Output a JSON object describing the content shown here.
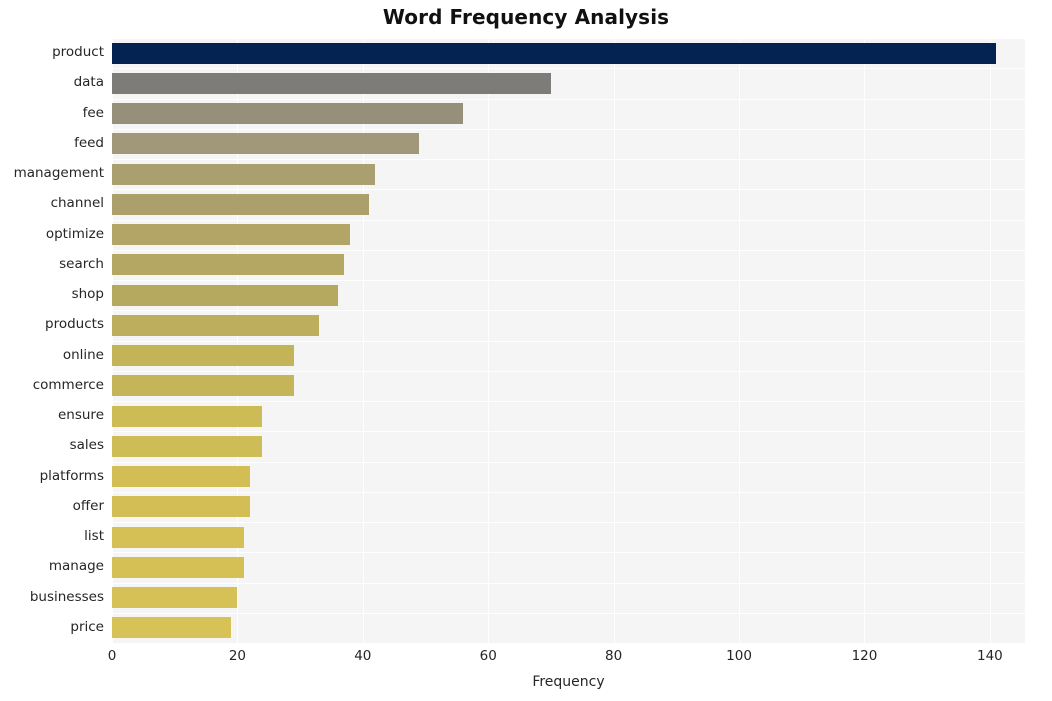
{
  "chart_data": {
    "type": "bar",
    "orientation": "horizontal",
    "title": "Word Frequency Analysis",
    "xlabel": "Frequency",
    "ylabel": "",
    "xlim": [
      0,
      145.6
    ],
    "xticks": [
      0,
      20,
      40,
      60,
      80,
      100,
      120,
      140
    ],
    "xticklabels": [
      "0",
      "20",
      "40",
      "60",
      "80",
      "100",
      "120",
      "140"
    ],
    "grid": true,
    "grid_axis": "both",
    "legend": false,
    "categories": [
      "product",
      "data",
      "fee",
      "feed",
      "management",
      "channel",
      "optimize",
      "search",
      "shop",
      "products",
      "online",
      "commerce",
      "ensure",
      "sales",
      "platforms",
      "offer",
      "list",
      "manage",
      "businesses",
      "price"
    ],
    "values": [
      141,
      70,
      56,
      49,
      42,
      41,
      38,
      37,
      36,
      33,
      29,
      29,
      24,
      24,
      22,
      22,
      21,
      21,
      20,
      19
    ],
    "bar_colors": [
      "#042353",
      "#7d7c79",
      "#96907a",
      "#a09878",
      "#aa9f6f",
      "#ab9f6c",
      "#b3a566",
      "#b4a763",
      "#b5a85f",
      "#bcae5c",
      "#c3b457",
      "#c4b558",
      "#cdbb56",
      "#cebc56",
      "#d2be55",
      "#d2be55",
      "#d4c055",
      "#d4c055",
      "#d5c156",
      "#d6c256"
    ],
    "plot_bgcolor": "#f5f5f6",
    "grid_color": "#ffffff",
    "fig_bgcolor": "#ffffff"
  }
}
